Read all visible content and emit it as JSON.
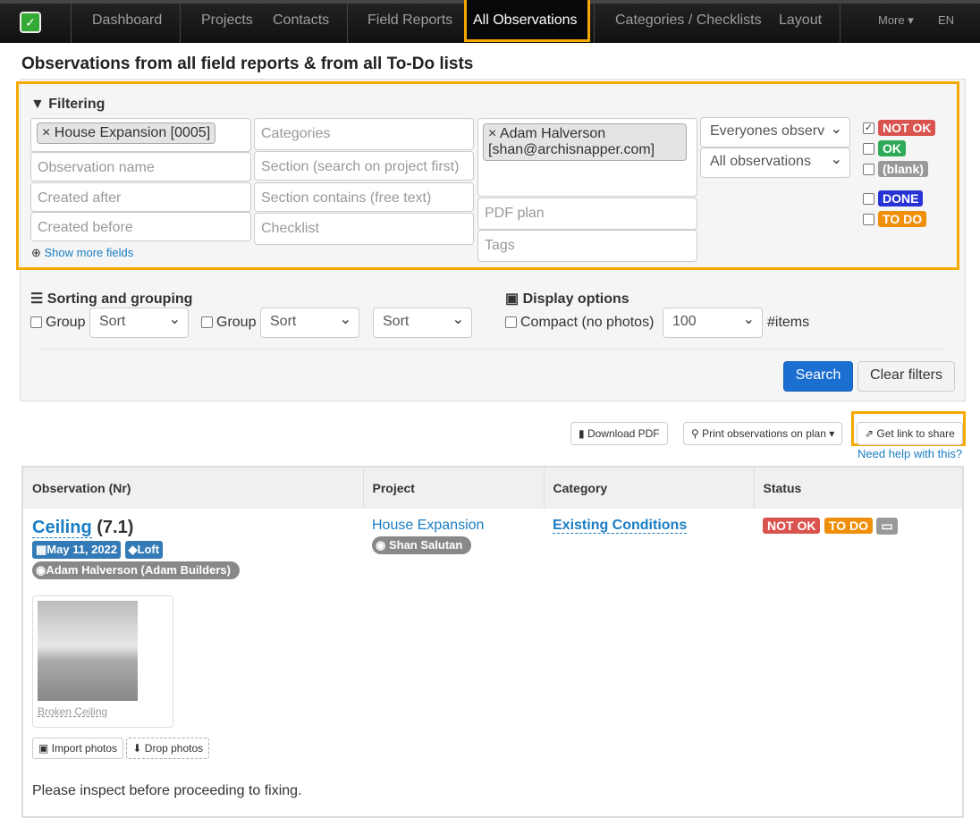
{
  "nav": {
    "items": [
      "Dashboard",
      "Projects",
      "Contacts",
      "Field Reports",
      "All Observations",
      "Categories / Checklists",
      "Layout"
    ],
    "more": "More ▾",
    "lang": "EN"
  },
  "title": "Observations from all field reports & from all To-Do lists",
  "filtering": {
    "heading": "Filtering",
    "project_tag": "House Expansion [0005]",
    "user_tag": "Adam Halverson [shan@archisnapper.com]",
    "placeholders": {
      "categories": "Categories",
      "obs_name": "Observation name",
      "section": "Section (search on project first)",
      "created_after": "Created after",
      "section_contains": "Section contains (free text)",
      "created_before": "Created before",
      "checklist": "Checklist",
      "pdf_plan": "PDF plan",
      "tags": "Tags"
    },
    "owner_select": "Everyones observ",
    "type_select": "All observations",
    "show_more": "Show more fields",
    "statuses": [
      {
        "label": "NOT OK",
        "color": "#d9534f",
        "checked": true
      },
      {
        "label": "OK",
        "color": "#2eaa58",
        "checked": false
      },
      {
        "label": "(blank)",
        "color": "#999999",
        "checked": false
      },
      {
        "label": "DONE",
        "color": "#2833d6",
        "checked": false
      },
      {
        "label": "TO DO",
        "color": "#f0900a",
        "checked": false
      }
    ]
  },
  "sorting": {
    "heading": "Sorting and grouping",
    "group": "Group",
    "sort": "Sort"
  },
  "display": {
    "heading": "Display options",
    "compact": "Compact (no photos)",
    "items": "100",
    "items_label": "#items"
  },
  "buttons": {
    "search": "Search",
    "clear": "Clear filters",
    "download_pdf": "Download PDF",
    "print": "Print observations on plan",
    "share": "Get link to share",
    "help": "Need help with this?"
  },
  "table": {
    "headers": [
      "Observation (Nr)",
      "Project",
      "Category",
      "Status"
    ],
    "row": {
      "title": "Ceiling",
      "nr": "(7.1)",
      "date": "May 11, 2022",
      "tag": "Loft",
      "assignee": "Adam Halverson (Adam Builders)",
      "project": "House Expansion",
      "user": "Shan Salutan",
      "category": "Existing Conditions",
      "status1": "NOT OK",
      "status2": "TO DO",
      "photo_caption": "Broken Ceiling",
      "import": "Import photos",
      "drop": "Drop photos",
      "description": "Please inspect before proceeding to fixing."
    }
  }
}
